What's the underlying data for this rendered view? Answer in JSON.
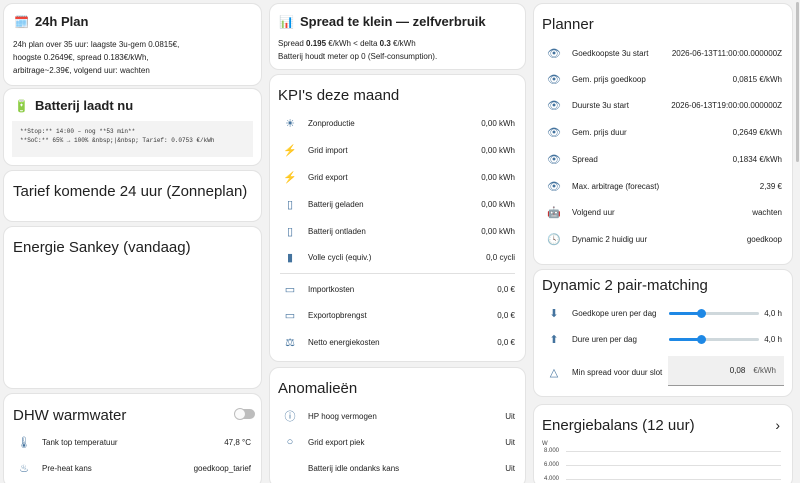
{
  "plan24": {
    "title": "24h Plan",
    "lines": [
      "24h plan over 35 uur: laagste 3u-gem 0.0815€,",
      "hoogste 0.2649€, spread 0.183€/kWh,",
      "arbitrage~2.39€, volgend uur: wachten"
    ]
  },
  "battery": {
    "title": "Batterij laadt nu",
    "code_line1": "**Stop:** 14:00 – nog **53 min**",
    "code_line2": "**SoC:** 65% → 100%  &nbsp;|&nbsp; Tarief: 0.0753 €/kWh"
  },
  "tariff": {
    "title": "Tarief komende 24 uur (Zonneplan)"
  },
  "sankey": {
    "title": "Energie Sankey (vandaag)"
  },
  "dhw": {
    "title": "DHW warmwater",
    "rows": [
      {
        "icon": "thermometer-icon",
        "label": "Tank top temperatuur",
        "value": "47,8 °C"
      },
      {
        "icon": "water-heater-icon",
        "label": "Pre-heat kans",
        "value": "goedkoop_tarief"
      }
    ]
  },
  "spread": {
    "title": "Spread te klein — zelfverbruik",
    "line1_prefix": "Spread ",
    "line1_spread": "0.195",
    "line1_mid": " €/kWh < delta ",
    "line1_delta": "0.3",
    "line1_suffix": " €/kWh",
    "line2": "Batterij houdt meter op 0 (Self-consumption)."
  },
  "kpi": {
    "title": "KPI's deze maand",
    "rows": [
      {
        "icon": "solar-power-icon",
        "label": "Zonproductie",
        "value": "0,00 kWh"
      },
      {
        "icon": "transmission-tower-import-icon",
        "label": "Grid import",
        "value": "0,00 kWh"
      },
      {
        "icon": "transmission-tower-export-icon",
        "label": "Grid export",
        "value": "0,00 kWh"
      },
      {
        "icon": "battery-charging-icon",
        "label": "Batterij geladen",
        "value": "0,00 kWh"
      },
      {
        "icon": "battery-minus-icon",
        "label": "Batterij ontladen",
        "value": "0,00 kWh"
      },
      {
        "icon": "battery-sync-icon",
        "label": "Volle cycli (equiv.)",
        "value": "0,0 cycli"
      },
      {
        "icon": "cash-minus-icon",
        "label": "Importkosten",
        "value": "0,0 €"
      },
      {
        "icon": "cash-plus-icon",
        "label": "Exportopbrengst",
        "value": "0,0 €"
      },
      {
        "icon": "scale-balance-icon",
        "label": "Netto energiekosten",
        "value": "0,0 €"
      }
    ]
  },
  "anomalies": {
    "title": "Anomalieën",
    "rows": [
      {
        "icon": "alert-circle-icon",
        "label": "HP hoog vermogen",
        "value": "Uit"
      },
      {
        "icon": "circle-outline-icon",
        "label": "Grid export piek",
        "value": "Uit"
      },
      {
        "icon": "battery-idle-icon",
        "label": "Batterij idle ondanks kans",
        "value": "Uit"
      }
    ]
  },
  "planner": {
    "title": "Planner",
    "rows": [
      {
        "icon": "eye-icon",
        "label": "Goedkoopste 3u start",
        "value": "2026-06-13T11:00:00.000000Z"
      },
      {
        "icon": "eye-icon",
        "label": "Gem. prijs goedkoop",
        "value": "0,0815 €/kWh"
      },
      {
        "icon": "eye-icon",
        "label": "Duurste 3u start",
        "value": "2026-06-13T19:00:00.000000Z"
      },
      {
        "icon": "eye-icon",
        "label": "Gem. prijs duur",
        "value": "0,2649 €/kWh"
      },
      {
        "icon": "eye-icon",
        "label": "Spread",
        "value": "0,1834 €/kWh"
      },
      {
        "icon": "eye-icon",
        "label": "Max. arbitrage (forecast)",
        "value": "2,39 €"
      },
      {
        "icon": "robot-icon",
        "label": "Volgend uur",
        "value": "wachten"
      },
      {
        "icon": "clock-icon",
        "label": "Dynamic 2 huidig uur",
        "value": "goedkoop"
      }
    ]
  },
  "pair": {
    "title": "Dynamic 2 pair-matching",
    "slider1_label": "Goedkope uren per dag",
    "slider1_value": "4,0 h",
    "slider1_level": 0.35,
    "slider2_label": "Dure uren per dag",
    "slider2_value": "4,0 h",
    "slider2_level": 0.35,
    "input_label": "Min spread voor duur slot",
    "input_value": "0,08",
    "input_unit": "€/kWh"
  },
  "balance": {
    "title": "Energiebalans (12 uur)",
    "unit": "W",
    "ticks": [
      "8.000",
      "6.000",
      "4.000"
    ]
  }
}
